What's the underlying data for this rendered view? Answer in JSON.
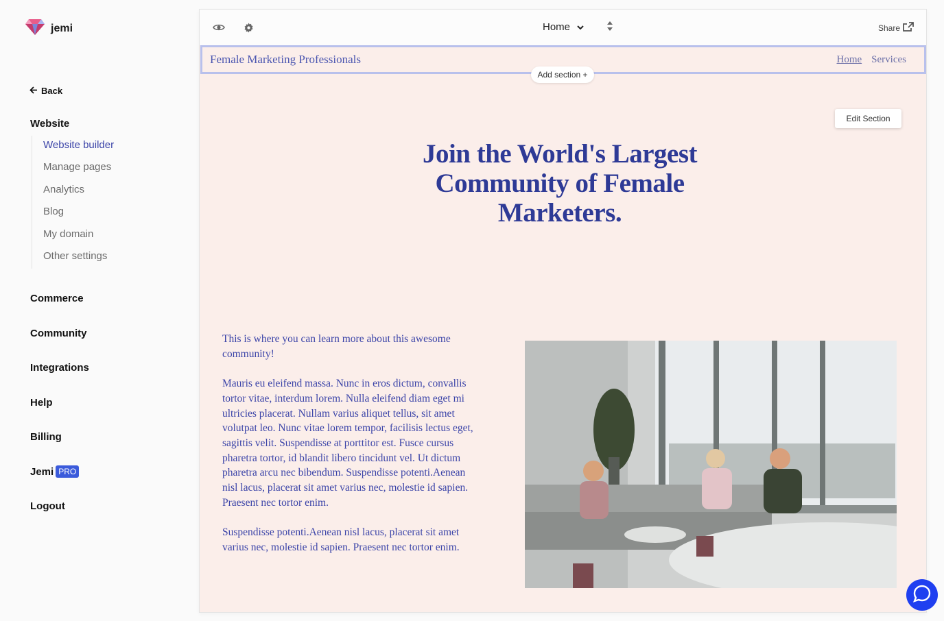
{
  "app": {
    "name": "jemi"
  },
  "sidebar": {
    "back_label": "Back",
    "website_label": "Website",
    "website_items": [
      {
        "label": "Website builder",
        "active": true
      },
      {
        "label": "Manage pages"
      },
      {
        "label": "Analytics"
      },
      {
        "label": "Blog"
      },
      {
        "label": "My domain"
      },
      {
        "label": "Other settings"
      }
    ],
    "sections": [
      "Commerce",
      "Community",
      "Integrations",
      "Help",
      "Billing"
    ],
    "jemi_pro_label": "Jemi",
    "pro_badge": "PRO",
    "logout_label": "Logout"
  },
  "toolbar": {
    "preview_icon": "eye-icon",
    "settings_icon": "gear-icon",
    "page_selected": "Home",
    "share_label": "Share"
  },
  "site": {
    "title": "Female Marketing Professionals",
    "nav": [
      "Home",
      "Services"
    ],
    "add_section_label": "Add section +",
    "edit_section_label": "Edit Section",
    "hero_title": "Join the World's Largest Community of Female Marketers.",
    "paragraphs": [
      "This is where you can learn more about this awesome community!",
      "Mauris eu eleifend massa. Nunc in eros dictum, convallis tortor vitae, interdum lorem. Nulla eleifend diam eget mi ultricies placerat. Nullam varius aliquet tellus, sit amet volutpat leo. Nunc vitae lorem tempor, facilisis lectus eget, sagittis velit. Suspendisse at porttitor est. Fusce cursus pharetra tortor, id blandit libero tincidunt vel. Ut dictum pharetra arcu nec bibendum. Suspendisse potenti.Aenean nisl lacus, placerat sit amet varius nec, molestie id sapien. Praesent nec tortor enim.",
      "Suspendisse potenti.Aenean nisl lacus, placerat sit amet varius nec, molestie id sapien. Praesent nec tortor enim."
    ]
  },
  "colors": {
    "accent": "#3b44a8",
    "canvas_bg": "#fbeeea",
    "header_border": "#b8c0ec",
    "chat_button": "#1f3ff0",
    "pro_badge": "#3b5bdb"
  }
}
